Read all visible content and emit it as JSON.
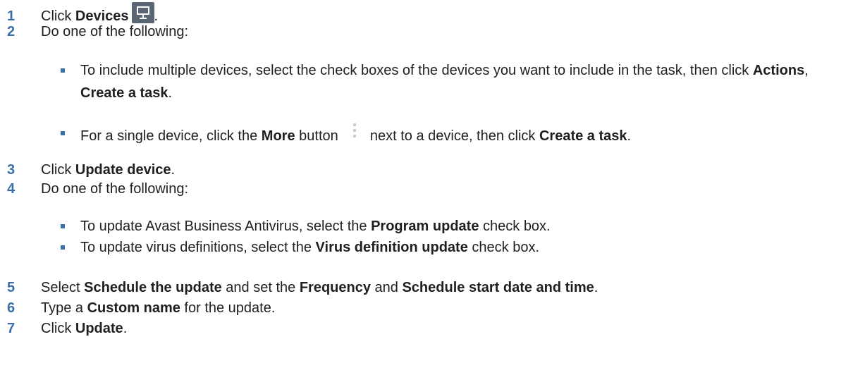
{
  "colors": {
    "step_number": "#3d6fa7",
    "bullet": "#3d6fa7",
    "text": "#1f1f1f"
  },
  "steps": {
    "s1": {
      "num": "1",
      "t1": "Click ",
      "b1": "Devices",
      "t2": ".",
      "icon": "monitor-icon"
    },
    "s2": {
      "num": "2",
      "t1": "Do one of the following:"
    },
    "s3": {
      "num": "3",
      "t1": "Click ",
      "b1": "Update device",
      "t2": "."
    },
    "s4": {
      "num": "4",
      "t1": "Do one of the following:"
    },
    "s5": {
      "num": "5",
      "t1": "Select ",
      "b1": "Schedule the update",
      "t2": " and set the ",
      "b2": "Frequency",
      "t3": " and ",
      "b3": "Schedule start date and time",
      "t4": "."
    },
    "s6": {
      "num": "6",
      "t1": "Type a ",
      "b1": "Custom name",
      "t2": " for the update."
    },
    "s7": {
      "num": "7",
      "t1": "Click ",
      "b1": "Update",
      "t2": "."
    }
  },
  "bullets": {
    "b2a": {
      "t1": "To include multiple devices, select the check boxes of the devices you want to include in the task, then click ",
      "b1": "Actions",
      "t2": ", ",
      "b2": "Create a task",
      "t3": "."
    },
    "b2b": {
      "t1": "For a single device, click the ",
      "b1": "More",
      "t2": " button ",
      "t3": " next to a device, then click ",
      "b2": "Create a task",
      "t4": ".",
      "icon": "more-vertical-icon"
    },
    "b4a": {
      "t1": "To update Avast Business Antivirus, select the ",
      "b1": "Program update",
      "t2": " check box."
    },
    "b4b": {
      "t1": "To update virus definitions, select the ",
      "b1": "Virus definition update",
      "t2": " check box."
    }
  }
}
